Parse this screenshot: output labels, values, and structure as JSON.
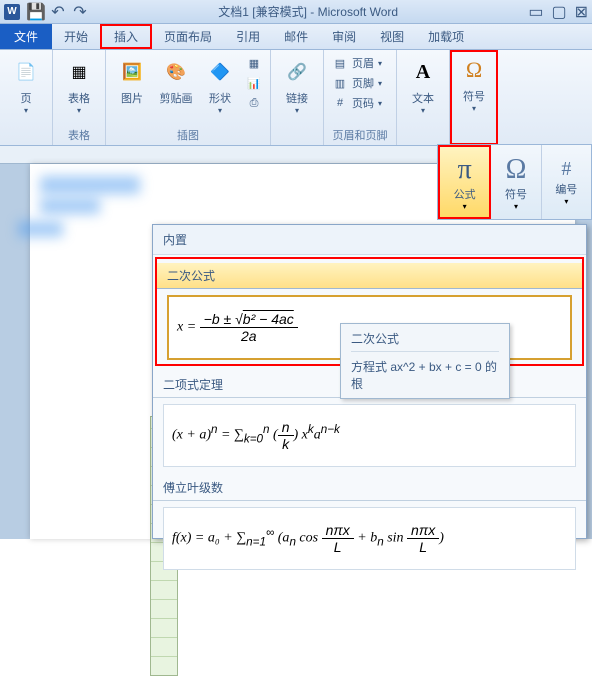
{
  "title": "文档1 [兼容模式] - Microsoft Word",
  "app_icon_letter": "W",
  "tabs": {
    "file": "文件",
    "home": "开始",
    "insert": "插入",
    "page_layout": "页面布局",
    "references": "引用",
    "mailings": "邮件",
    "review": "审阅",
    "view": "视图",
    "addins": "加载项"
  },
  "groups": {
    "pages": {
      "btn": "页",
      "label": ""
    },
    "tables": {
      "btn": "表格",
      "label": "表格"
    },
    "illustrations": {
      "picture": "图片",
      "clipart": "剪贴画",
      "shapes": "形状",
      "smartart_icon": "▦",
      "chart_icon": "📊",
      "screenshot_icon": "⎙",
      "label": "插图"
    },
    "links": {
      "hyperlink": "链接"
    },
    "header_footer": {
      "header": "页眉",
      "footer": "页脚",
      "page_number": "页码",
      "label": "页眉和页脚"
    },
    "text": {
      "textbox": "文本"
    },
    "symbols": {
      "symbol": "符号"
    }
  },
  "equation_toolbar": {
    "equation": {
      "glyph": "π",
      "label": "公式"
    },
    "symbol": {
      "glyph": "Ω",
      "label": "符号"
    },
    "number": {
      "glyph": "#",
      "label": "编号"
    }
  },
  "eq_dropdown": {
    "header": "内置",
    "sections": [
      {
        "title": "二次公式",
        "formula_html": "x = <span class='frac'><span class='num'>−b ± <span class='sqrt-sym'></span><span class='overline'>b² − 4ac</span></span><span class='den'>2a</span></span>"
      },
      {
        "title": "二项式定理",
        "formula_html": "(x + a)<sup>n</sup> = ∑<sub>k=0</sub><sup>n</sup> (<span class='frac'><span class='num'>n</span><span class='den'>k</span></span>) x<sup>k</sup>a<sup>n−k</sup>"
      },
      {
        "title": "傅立叶级数",
        "formula_html": "f(x) = a₀ + ∑<sub>n=1</sub><sup>∞</sup> (a<sub>n</sub> cos <span class='frac'><span class='num'>nπx</span><span class='den'>L</span></span> + b<sub>n</sub> sin <span class='frac'><span class='num'>nπx</span><span class='den'>L</span></span>)"
      }
    ]
  },
  "tooltip": {
    "title": "二次公式",
    "body": "方程式 ax^2 + bx + c = 0 的根"
  }
}
